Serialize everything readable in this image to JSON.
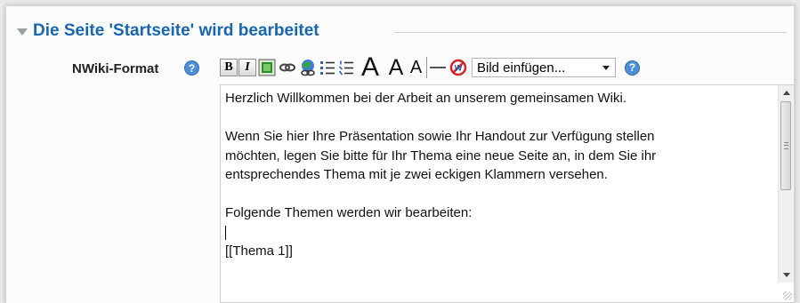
{
  "section": {
    "title": "Die Seite 'Startseite' wird bearbeitet"
  },
  "field": {
    "label": "NWiki-Format"
  },
  "toolbar": {
    "bold_label": "B",
    "italic_label": "I",
    "heading_labels": [
      "A",
      "A",
      "A"
    ],
    "image_select": "Bild einfügen...",
    "help_label": "?"
  },
  "editor": {
    "lines": [
      "Herzlich Willkommen bei der Arbeit an unserem gemeinsamen Wiki.",
      "",
      "Wenn Sie hier Ihre Präsentation sowie Ihr Handout zur Verfügung stellen",
      "möchten, legen Sie bitte für Ihr Thema eine neue Seite an, in dem Sie ihr",
      "entsprechendes Thema mit je zwei eckigen Klammern versehen.",
      "",
      "Folgende Themen werden wir bearbeiten:",
      "",
      "[[Thema 1]]"
    ]
  },
  "colors": {
    "title": "#1865b0",
    "help_icon": "#4d8fd6"
  },
  "icons": [
    "collapse-triangle-icon",
    "help-icon",
    "bold-icon",
    "italic-icon",
    "image-icon",
    "link-icon",
    "wiki-link-icon",
    "bullet-list-icon",
    "numbered-list-icon",
    "heading-1-icon",
    "heading-2-icon",
    "heading-3-icon",
    "horizontal-rule-icon",
    "no-wiki-icon",
    "chevron-down-icon",
    "scroll-up-icon",
    "scroll-down-icon",
    "resize-handle-icon"
  ]
}
